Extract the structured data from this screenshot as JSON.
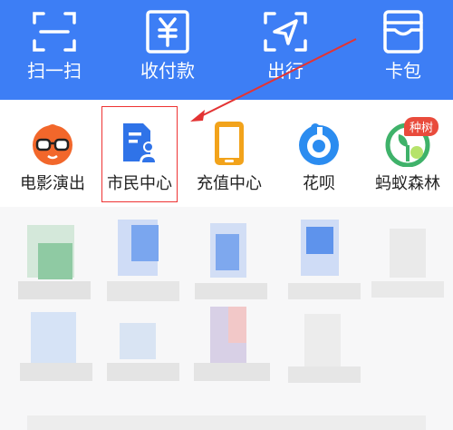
{
  "top_actions": [
    {
      "label": "扫一扫",
      "icon": "scan-icon"
    },
    {
      "label": "收付款",
      "icon": "payment-code-icon"
    },
    {
      "label": "出行",
      "icon": "travel-arrow-icon"
    },
    {
      "label": "卡包",
      "icon": "card-wallet-icon"
    }
  ],
  "apps": [
    {
      "label": "电影演出",
      "icon": "movie-mascot-icon"
    },
    {
      "label": "市民中心",
      "icon": "citizen-center-icon"
    },
    {
      "label": "充值中心",
      "icon": "phone-recharge-icon"
    },
    {
      "label": "花呗",
      "icon": "huabei-icon"
    },
    {
      "label": "蚂蚁森林",
      "icon": "ant-forest-icon"
    }
  ],
  "badge": {
    "text": "种树"
  },
  "colors": {
    "header": "#3d7ef5",
    "highlight": "#e33333"
  }
}
